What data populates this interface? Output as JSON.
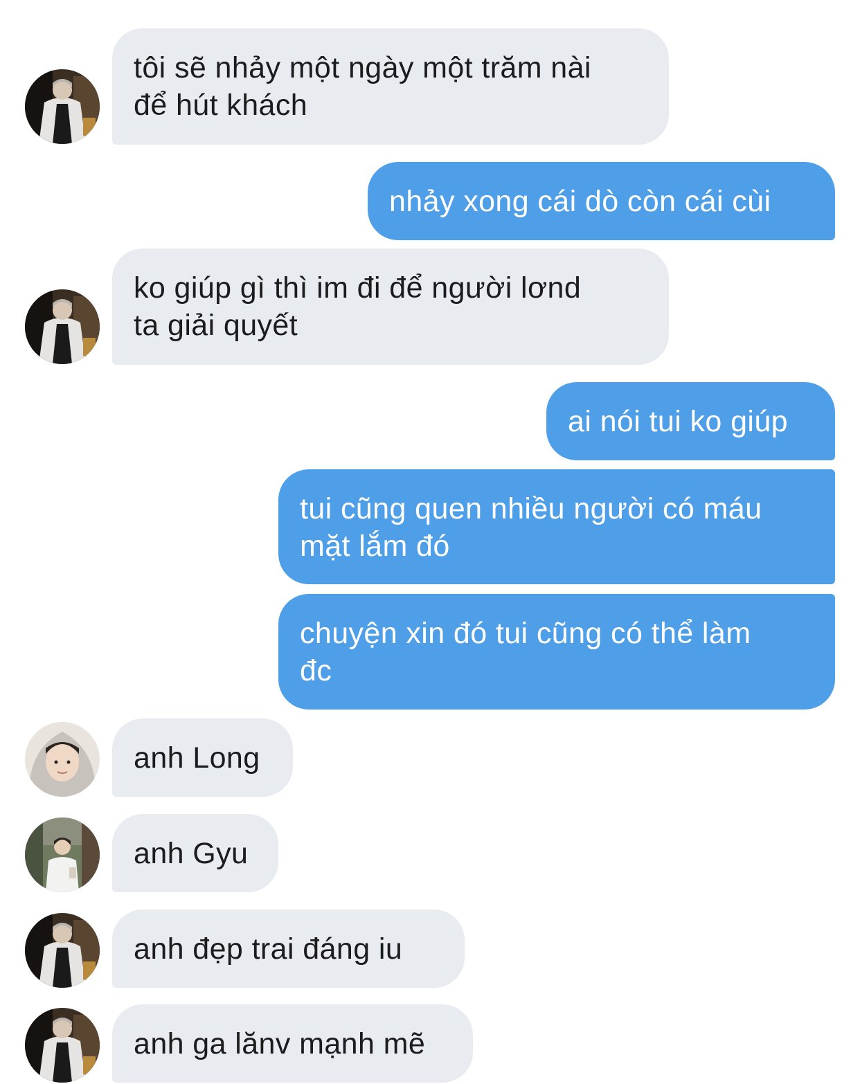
{
  "colors": {
    "incoming_bubble": "#e8ebef",
    "outgoing_bubble": "#4f9ee8",
    "incoming_text": "#1c1c1e",
    "outgoing_text": "#ffffff",
    "background": "#ffffff"
  },
  "messages": [
    {
      "direction": "incoming",
      "avatar": "avatar-dark-jacket",
      "text": "tôi sẽ nhảy một ngày một trăm nài\nđể hút khách"
    },
    {
      "direction": "outgoing",
      "text": "nhảy xong cái dò còn cái cùi"
    },
    {
      "direction": "incoming",
      "avatar": "avatar-dark-jacket",
      "text": "ko giúp gì thì im đi để người lơnd\nta giải quyết"
    },
    {
      "direction": "outgoing",
      "text": "ai nói tui ko giúp"
    },
    {
      "direction": "outgoing",
      "text": "tui cũng quen nhiều người có máu\nmặt lắm đó"
    },
    {
      "direction": "outgoing",
      "text": "chuyện xin đó tui cũng có thể làm\nđc"
    },
    {
      "direction": "incoming",
      "avatar": "avatar-hoodie",
      "text": "anh Long"
    },
    {
      "direction": "incoming",
      "avatar": "avatar-white-shirt",
      "text": "anh Gyu"
    },
    {
      "direction": "incoming",
      "avatar": "avatar-dark-jacket",
      "text": "anh đẹp trai đáng iu"
    },
    {
      "direction": "incoming",
      "avatar": "avatar-dark-jacket",
      "text": "anh ga lănv mạnh mẽ"
    }
  ]
}
